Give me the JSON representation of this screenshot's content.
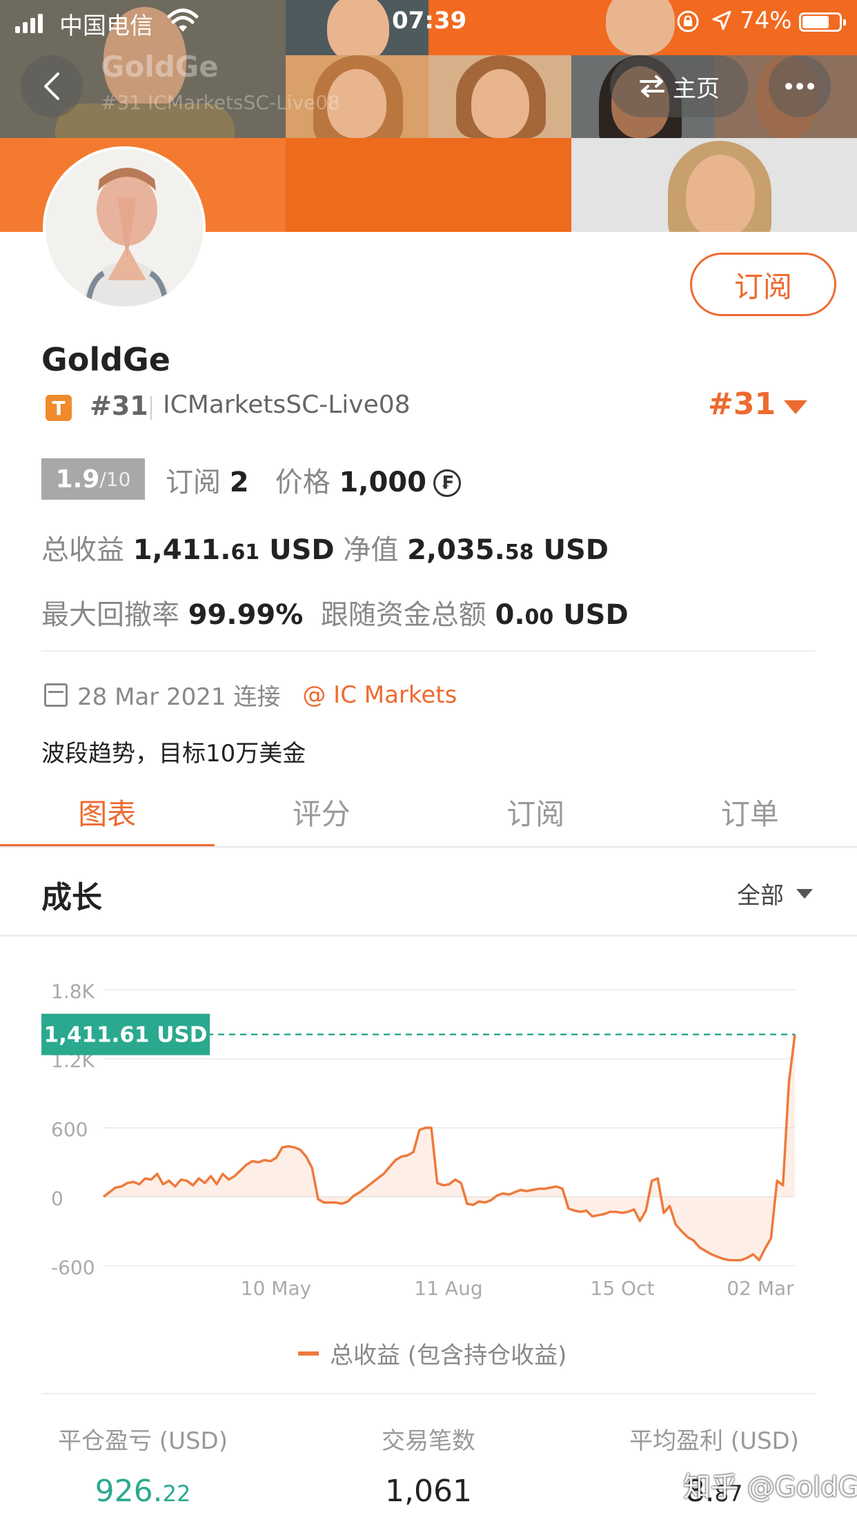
{
  "status_bar": {
    "carrier": "中国电信",
    "time": "07:39",
    "battery": "74%",
    "battery_level": 0.74
  },
  "nav": {
    "home_label": "主页",
    "ghost_title": "GoldGe",
    "ghost_subtitle": "#31 ICMarketsSC-Live08"
  },
  "profile": {
    "subscribe_label": "订阅",
    "name": "GoldGe",
    "badge": "T",
    "rank": "#31",
    "server": "ICMarketsSC-Live08",
    "rank_display": "#31",
    "score_main": "1.9",
    "score_denom": "/10",
    "subscribers_label": "订阅",
    "subscribers": "2",
    "price_label": "价格",
    "price": "1,000",
    "coin_symbol": "₣",
    "total_profit_label": "总收益",
    "total_profit_int": "1,411.",
    "total_profit_dec": "61",
    "total_profit_unit": "USD",
    "equity_label": "净值",
    "equity_int": "2,035.",
    "equity_dec": "58",
    "equity_unit": "USD",
    "drawdown_label": "最大回撤率",
    "drawdown": "99.99%",
    "follow_label": "跟随资金总额",
    "follow_int": "0.",
    "follow_dec": "00",
    "follow_unit": "USD",
    "joined": "28 Mar 2021 连接",
    "broker": "@ IC Markets",
    "bio": "波段趋势，目标10万美金"
  },
  "tabs": [
    "图表",
    "评分",
    "订阅",
    "订单"
  ],
  "growth": {
    "title": "成长",
    "range": "全部"
  },
  "chart_data": {
    "type": "area",
    "y_ticks": [
      "1.8K",
      "1.2K",
      "600",
      "0",
      "-600"
    ],
    "ylim": [
      -600,
      1800
    ],
    "x_ticks": [
      "10 May",
      "11 Aug",
      "15 Oct",
      "02 Mar"
    ],
    "current_label": "1,411.61 USD",
    "current_value": 1411.61,
    "series": [
      {
        "name": "总收益 (包含持仓收益)",
        "color": "#ee7a3c",
        "values": [
          0,
          40,
          80,
          90,
          120,
          130,
          110,
          160,
          150,
          200,
          110,
          140,
          90,
          150,
          140,
          100,
          160,
          120,
          180,
          110,
          200,
          150,
          180,
          230,
          280,
          310,
          300,
          320,
          310,
          340,
          430,
          440,
          430,
          410,
          350,
          250,
          -20,
          -50,
          -50,
          -50,
          -60,
          -40,
          10,
          40,
          80,
          120,
          160,
          200,
          260,
          320,
          350,
          360,
          390,
          580,
          600,
          600,
          120,
          100,
          110,
          150,
          120,
          -60,
          -70,
          -40,
          -50,
          -30,
          10,
          30,
          20,
          40,
          60,
          50,
          60,
          70,
          70,
          80,
          90,
          70,
          -100,
          -120,
          -130,
          -120,
          -170,
          -160,
          -150,
          -130,
          -130,
          -140,
          -130,
          -110,
          -210,
          -120,
          140,
          160,
          -140,
          -80,
          -240,
          -300,
          -350,
          -380,
          -440,
          -470,
          -500,
          -520,
          -540,
          -550,
          -550,
          -550,
          -530,
          -500,
          -550,
          -450,
          -360,
          140,
          100,
          1000,
          1411.61
        ]
      }
    ]
  },
  "legend_label": "总收益 (包含持仓收益)",
  "stats": [
    {
      "label": "平仓盈亏 (USD)",
      "int": "926.",
      "dec": "22"
    },
    {
      "label": "交易笔数",
      "int": "1,061",
      "dec": ""
    },
    {
      "label": "平均盈利 (USD)",
      "int": "8.",
      "dec": "87"
    }
  ],
  "watermark": "知乎 @GoldGe"
}
